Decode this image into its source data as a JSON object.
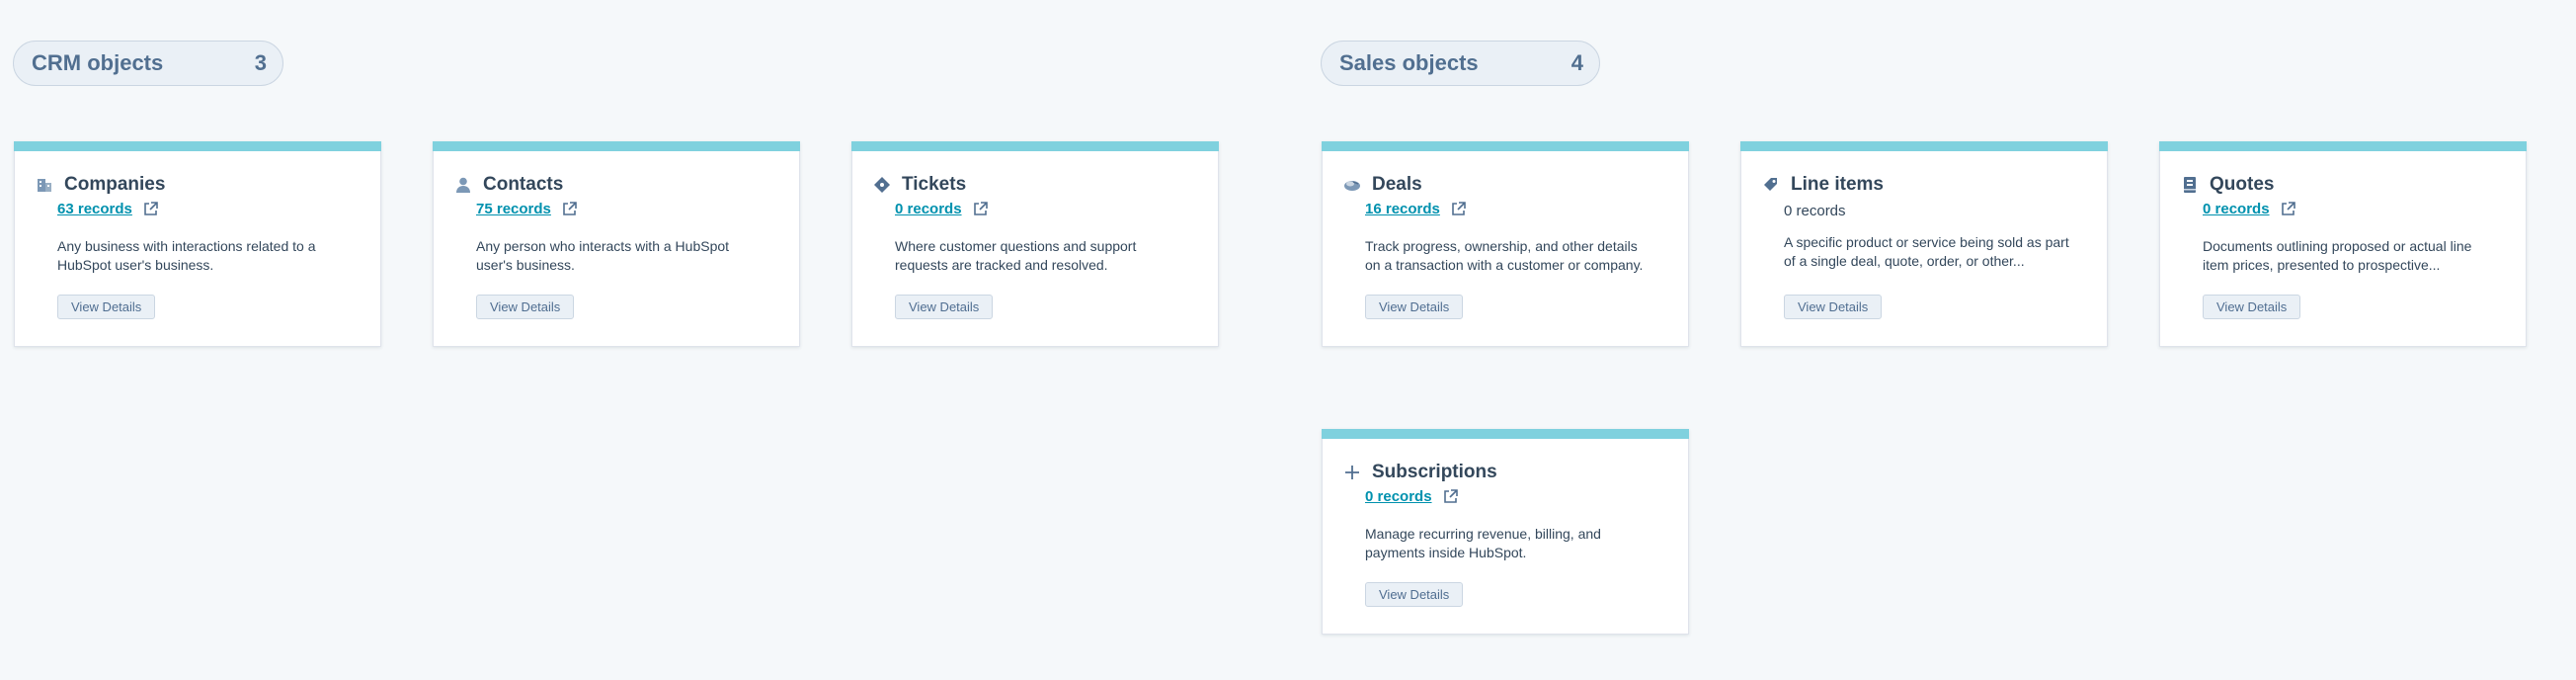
{
  "groups": [
    {
      "title": "CRM objects",
      "count": "3"
    },
    {
      "title": "Sales objects",
      "count": "4"
    }
  ],
  "cards": [
    {
      "title": "Companies",
      "records": "63 records",
      "description": "Any business with interactions related to a HubSpot user's business.",
      "button": "View Details",
      "icon": "building-icon"
    },
    {
      "title": "Contacts",
      "records": "75 records",
      "description": "Any person who interacts with a HubSpot user's business.",
      "button": "View Details",
      "icon": "person-icon"
    },
    {
      "title": "Tickets",
      "records": "0 records",
      "description": "Where customer questions and support requests are tracked and resolved.",
      "button": "View Details",
      "icon": "ticket-icon"
    },
    {
      "title": "Deals",
      "records": "16 records",
      "description": "Track progress, ownership, and other details on a transaction with a customer or company.",
      "button": "View Details",
      "icon": "handshake-icon"
    },
    {
      "title": "Line items",
      "records": "0 records",
      "description": "A specific product or service being sold as part of a single deal, quote, order, or other...",
      "button": "View Details",
      "icon": "tag-icon"
    },
    {
      "title": "Quotes",
      "records": "0 records",
      "description": "Documents outlining proposed or actual line item prices, presented to prospective...",
      "button": "View Details",
      "icon": "quote-icon"
    },
    {
      "title": "Subscriptions",
      "records": "0 records",
      "description": "Manage recurring revenue, billing, and payments inside HubSpot.",
      "button": "View Details",
      "icon": "plus-icon"
    }
  ],
  "colors": {
    "accent_bar": "#7fd1de",
    "link": "#0091ae",
    "text": "#33475b",
    "background": "#f5f8fa"
  }
}
